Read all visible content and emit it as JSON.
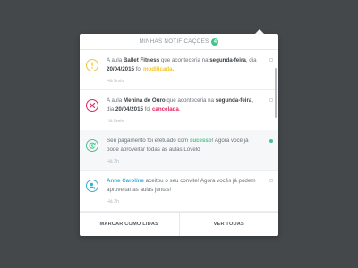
{
  "header": {
    "title": "Minhas notificações",
    "count": "4"
  },
  "colors": {
    "background": "#44484b",
    "accent_green": "#46c38b",
    "warning_yellow": "#f5c623",
    "danger_red": "#e0245e",
    "info_blue": "#2fb2d8"
  },
  "notifications": [
    {
      "icon": "warning-icon",
      "parts": [
        "A aula ",
        "Ballet Fitness",
        " que aconteceria na ",
        "segunda-feira",
        ", dia ",
        "20/04/2015",
        " foi ",
        "modificada",
        "."
      ],
      "time": "Há 5min",
      "unread": false
    },
    {
      "icon": "cancel-icon",
      "parts": [
        "A aula ",
        "Menina de Ouro",
        " que aconteceria na ",
        "segunda-feira",
        ", dia ",
        "20/04/2015",
        " foi ",
        "cancelada",
        "."
      ],
      "time": "Há 5min",
      "unread": false
    },
    {
      "icon": "payment-refresh-icon",
      "parts": [
        "Seu pagamento foi efetuado com ",
        "sucesso",
        "! Agora você já pode aproveitar todas as aulas Lovelô"
      ],
      "time": "Há 2h",
      "unread": true
    },
    {
      "icon": "user-add-icon",
      "parts": [
        "Anne Caroline",
        " aceitou o seu convite! Agora vocês já podem aproveitar as aulas juntas!"
      ],
      "time": "Há 2h",
      "unread": false
    }
  ],
  "footer": {
    "mark_read": "Marcar como lidas",
    "see_all": "Ver todas"
  }
}
